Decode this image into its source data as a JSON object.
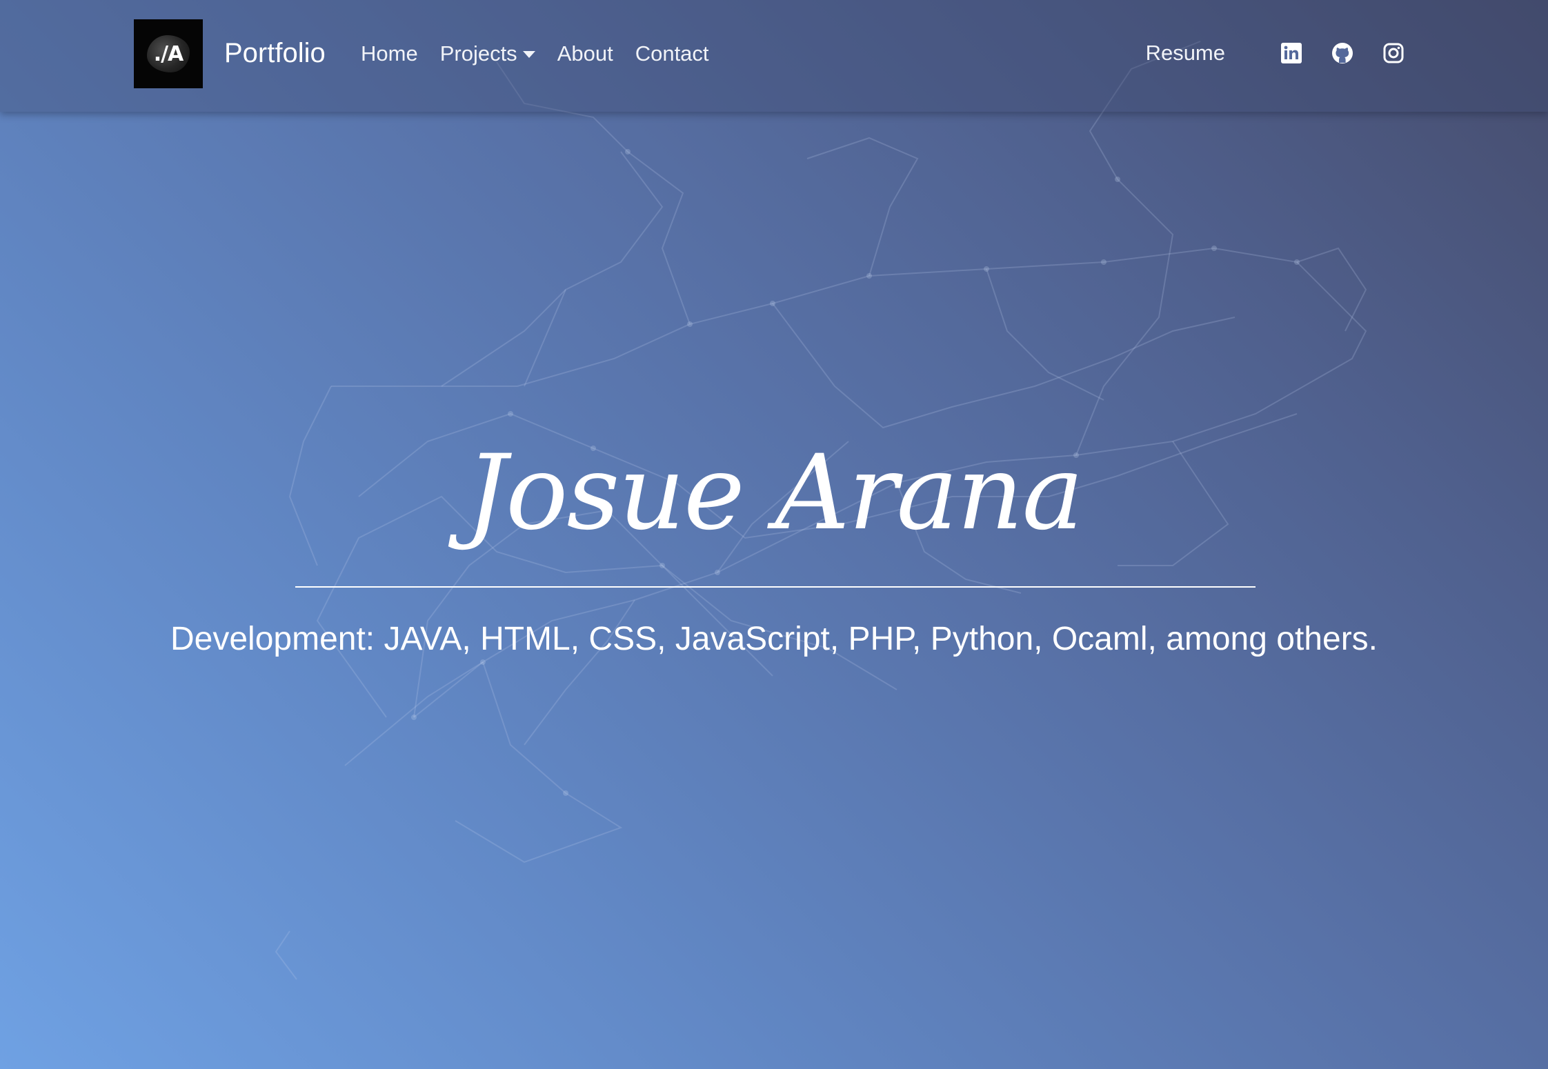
{
  "navbar": {
    "logo_text": "./A",
    "brand": "Portfolio",
    "links": [
      {
        "label": "Home"
      },
      {
        "label": "Projects"
      },
      {
        "label": "About"
      },
      {
        "label": "Contact"
      }
    ],
    "resume_label": "Resume",
    "social_icons": [
      "linkedin-icon",
      "github-icon",
      "instagram-icon"
    ]
  },
  "hero": {
    "name": "Josue Arana",
    "subtitle": "Development: JAVA, HTML, CSS, JavaScript, PHP, Python, Ocaml, among others."
  },
  "colors": {
    "gradient_light": "#6fa1e3",
    "gradient_dark": "#464c6c",
    "text": "#ffffff"
  }
}
